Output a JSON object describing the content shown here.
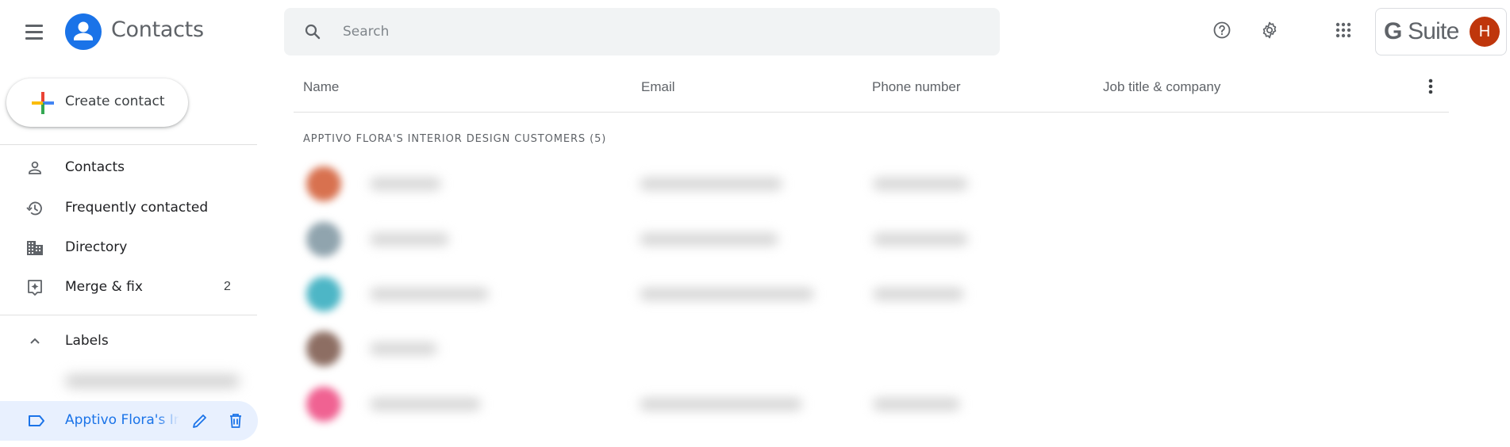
{
  "app": {
    "title": "Contacts",
    "menu_icon": "hamburger-menu-icon",
    "logo_icon": "contacts-logo-icon"
  },
  "search": {
    "placeholder": "Search",
    "value": "",
    "icon": "search-icon"
  },
  "topbar": {
    "help_icon": "help-icon",
    "settings_icon": "gear-icon",
    "apps_icon": "apps-grid-icon",
    "brand": {
      "g": "G",
      "suite": " Suite"
    },
    "user_initial": "H",
    "user_avatar_color": "#bf360c"
  },
  "sidebar": {
    "create_label": "Create contact",
    "items": [
      {
        "label": "Contacts",
        "icon": "person-icon",
        "count": ""
      },
      {
        "label": "Frequently contacted",
        "icon": "history-icon",
        "count": ""
      },
      {
        "label": "Directory",
        "icon": "building-icon",
        "count": ""
      },
      {
        "label": "Merge & fix",
        "icon": "merge-fix-icon",
        "count": "2"
      }
    ],
    "labels_header": "Labels",
    "labels": [
      {
        "label": "[redacted]",
        "blurred": true,
        "selected": false
      },
      {
        "label": "Apptivo Flora's Interior Design Customers",
        "blurred": false,
        "selected": true
      }
    ],
    "accent_color": "#1a73e8",
    "selected_bg": "#e8f0fe"
  },
  "table": {
    "columns": [
      "Name",
      "Email",
      "Phone number",
      "Job title & company"
    ],
    "group_title": "APPTIVO FLORA'S INTERIOR DESIGN CUSTOMERS (5)",
    "rows": [
      {
        "avatar_color": "#d8714f",
        "name": "[blurred]",
        "email": "[blurred]",
        "phone": "[blurred]",
        "job": ""
      },
      {
        "avatar_color": "#90a4ae",
        "name": "[blurred]",
        "email": "[blurred]",
        "phone": "[blurred]",
        "job": ""
      },
      {
        "avatar_color": "#4db6c6",
        "name": "[blurred]",
        "email": "[blurred]",
        "phone": "[blurred]",
        "job": ""
      },
      {
        "avatar_color": "#8d6e63",
        "name": "[blurred]",
        "email": "",
        "phone": "",
        "job": ""
      },
      {
        "avatar_color": "#f06292",
        "name": "[blurred]",
        "email": "[blurred]",
        "phone": "[blurred]",
        "job": ""
      }
    ]
  }
}
